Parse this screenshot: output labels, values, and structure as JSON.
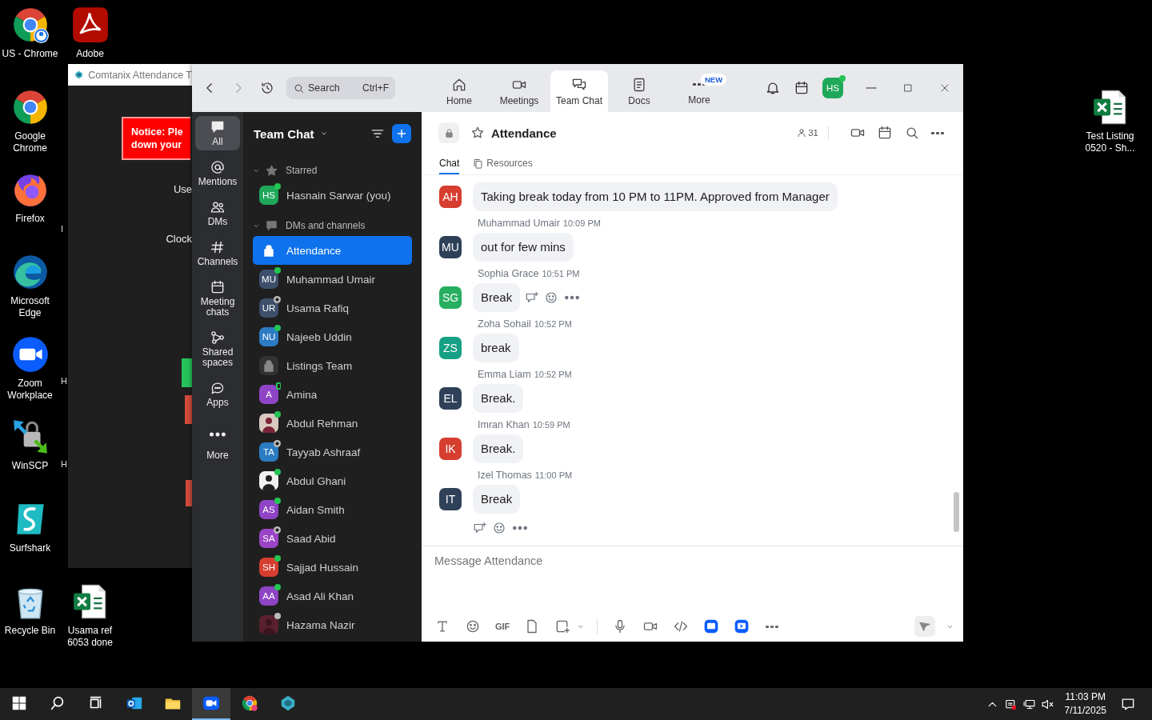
{
  "desktop_icons": [
    {
      "label": "US - Chrome",
      "kind": "chrome_profile"
    },
    {
      "label": "Adobe",
      "kind": "acrobat"
    },
    {
      "label": "Google Chrome",
      "kind": "chrome"
    },
    {
      "label": "Firefox",
      "kind": "firefox"
    },
    {
      "label": "Microsoft Edge",
      "kind": "edge"
    },
    {
      "label": "Zoom Workplace",
      "kind": "zoom"
    },
    {
      "label": "WinSCP",
      "kind": "winscp"
    },
    {
      "label": "Surfshark",
      "kind": "surfshark"
    },
    {
      "label": "Recycle Bin",
      "kind": "recycle"
    },
    {
      "label": "Usama ref 6053 done",
      "kind": "excel"
    },
    {
      "label": "Test Listing 0520 - Sh...",
      "kind": "excel"
    }
  ],
  "background_window": {
    "title": "Comtanix Attendance T",
    "notice": [
      "Notice: Ple",
      "down your"
    ],
    "labels": [
      "Use",
      "Clock"
    ],
    "edge_letters": [
      "I",
      "H",
      "H"
    ]
  },
  "zoom": {
    "nav": {
      "search": {
        "placeholder": "Search",
        "shortcut": "Ctrl+F"
      },
      "tabs": [
        {
          "label": "Home",
          "selected": false
        },
        {
          "label": "Meetings",
          "selected": false
        },
        {
          "label": "Team Chat",
          "selected": true
        },
        {
          "label": "Docs",
          "selected": false
        },
        {
          "label": "More",
          "selected": false,
          "badge": "NEW"
        }
      ],
      "profile": {
        "initials": "HS",
        "status": {
          "kind": "dot",
          "color": "#23c552"
        }
      }
    },
    "rail": [
      {
        "label": "All",
        "selected": true
      },
      {
        "label": "Mentions",
        "selected": false
      },
      {
        "label": "DMs",
        "selected": false
      },
      {
        "label": "Channels",
        "selected": false
      },
      {
        "label": "Meeting chats",
        "selected": false
      },
      {
        "label": "Shared spaces",
        "selected": false
      },
      {
        "label": "Apps",
        "selected": false
      },
      {
        "label": "More",
        "selected": false
      }
    ],
    "list": {
      "title": "Team Chat",
      "sections": [
        {
          "label": "Starred",
          "expanded": true,
          "items": [
            {
              "name": "Hasnain Sarwar (you)",
              "kind": "initials",
              "initials": "HS",
              "color": "#1fa85a",
              "status": {
                "kind": "dot",
                "color": "#23c552"
              },
              "selected": false
            }
          ]
        },
        {
          "label": "DMs and channels",
          "expanded": true,
          "items": [
            {
              "name": "Attendance",
              "kind": "channel",
              "selected": true
            },
            {
              "name": "Muhammad Umair",
              "kind": "initials",
              "initials": "MU",
              "color": "#3d4f6b",
              "status": {
                "kind": "dot",
                "color": "#23c552"
              },
              "selected": false
            },
            {
              "name": "Usama Rafiq",
              "kind": "initials",
              "initials": "UR",
              "color": "#3d4f6b",
              "status": {
                "kind": "ring",
                "color": "#bbbbbb"
              },
              "selected": false
            },
            {
              "name": "Najeeb Uddin",
              "kind": "initials",
              "initials": "NU",
              "color": "#2c7cc4",
              "status": {
                "kind": "dot",
                "color": "#23c552"
              },
              "selected": false
            },
            {
              "name": "Listings Team",
              "kind": "channel",
              "selected": false
            },
            {
              "name": "Amina",
              "kind": "initials",
              "initials": "A",
              "color": "#8e44c4",
              "status": {
                "kind": "phone",
                "color": "#23c552"
              },
              "selected": false
            },
            {
              "name": "Abdul Rehman",
              "status": {
                "kind": "dot",
                "color": "#23c552"
              },
              "selected": false
            },
            {
              "name": "Tayyab Ashraaf",
              "kind": "initials",
              "initials": "TA",
              "color": "#2c7cc4",
              "status": {
                "kind": "ring",
                "color": "#bbbbbb"
              },
              "selected": false
            },
            {
              "name": "Abdul Ghani",
              "status": {
                "kind": "dot",
                "color": "#23c552"
              },
              "selected": false
            },
            {
              "name": "Aidan Smith",
              "kind": "initials",
              "initials": "AS",
              "color": "#8e44c4",
              "status": {
                "kind": "dot",
                "color": "#23c552"
              },
              "selected": false
            },
            {
              "name": "Saad Abid",
              "kind": "initials",
              "initials": "SA",
              "color": "#9b45c6",
              "status": {
                "kind": "ring",
                "color": "#bbbbbb"
              },
              "selected": false
            },
            {
              "name": "Sajjad Hussain",
              "kind": "initials",
              "initials": "SH",
              "color": "#d63e2f",
              "status": {
                "kind": "dot",
                "color": "#23c552"
              },
              "selected": false
            },
            {
              "name": "Asad Ali Khan",
              "kind": "initials",
              "initials": "AA",
              "color": "#8e44c4",
              "status": {
                "kind": "dot",
                "color": "#23c552"
              },
              "selected": false
            },
            {
              "name": "Hazama Nazir",
              "status": {
                "kind": "dot",
                "color": "#bbbbbb"
              },
              "selected": false
            }
          ]
        }
      ]
    },
    "chat": {
      "title": "Attendance",
      "members": "31",
      "tabs": [
        {
          "label": "Chat",
          "selected": true
        },
        {
          "label": "Resources",
          "selected": false
        }
      ],
      "messages": [
        {
          "initials": "AH",
          "color": "#d63e2f",
          "text": "Taking break today from 10 PM to 11PM. Approved from Manager",
          "actions_shown": false
        },
        {
          "initials": "MU",
          "color": "#2f4159",
          "sender": "Muhammad Umair",
          "time": "10:09 PM",
          "text": "out for few mins",
          "actions_shown": false
        },
        {
          "initials": "SG",
          "color": "#27ae60",
          "sender": "Sophia Grace",
          "time": "10:51 PM",
          "text": "Break",
          "actions_shown": true
        },
        {
          "initials": "ZS",
          "color": "#16a085",
          "sender": "Zoha Sohail",
          "time": "10:52 PM",
          "text": "break",
          "actions_shown": false
        },
        {
          "initials": "EL",
          "color": "#2f4159",
          "sender": "Emma Liam",
          "time": "10:52 PM",
          "text": "Break.",
          "actions_shown": false
        },
        {
          "initials": "IK",
          "color": "#d63e2f",
          "sender": "Imran Khan",
          "time": "10:59 PM",
          "text": "Break.",
          "actions_shown": false
        },
        {
          "initials": "IT",
          "color": "#2f4159",
          "sender": "Izel Thomas",
          "time": "11:00 PM",
          "text": "Break",
          "actions_shown": true
        }
      ],
      "compose": {
        "placeholder": "Message Attendance",
        "gif_label": "GIF"
      }
    }
  },
  "taskbar": {
    "apps": [
      {
        "kind": "outlook",
        "active": false
      },
      {
        "kind": "explorer",
        "active": false
      },
      {
        "kind": "zoom",
        "active": true
      },
      {
        "kind": "chrome",
        "active": false
      },
      {
        "kind": "comtanix",
        "active": false
      }
    ],
    "time": "11:03 PM",
    "date": "7/11/2025"
  }
}
